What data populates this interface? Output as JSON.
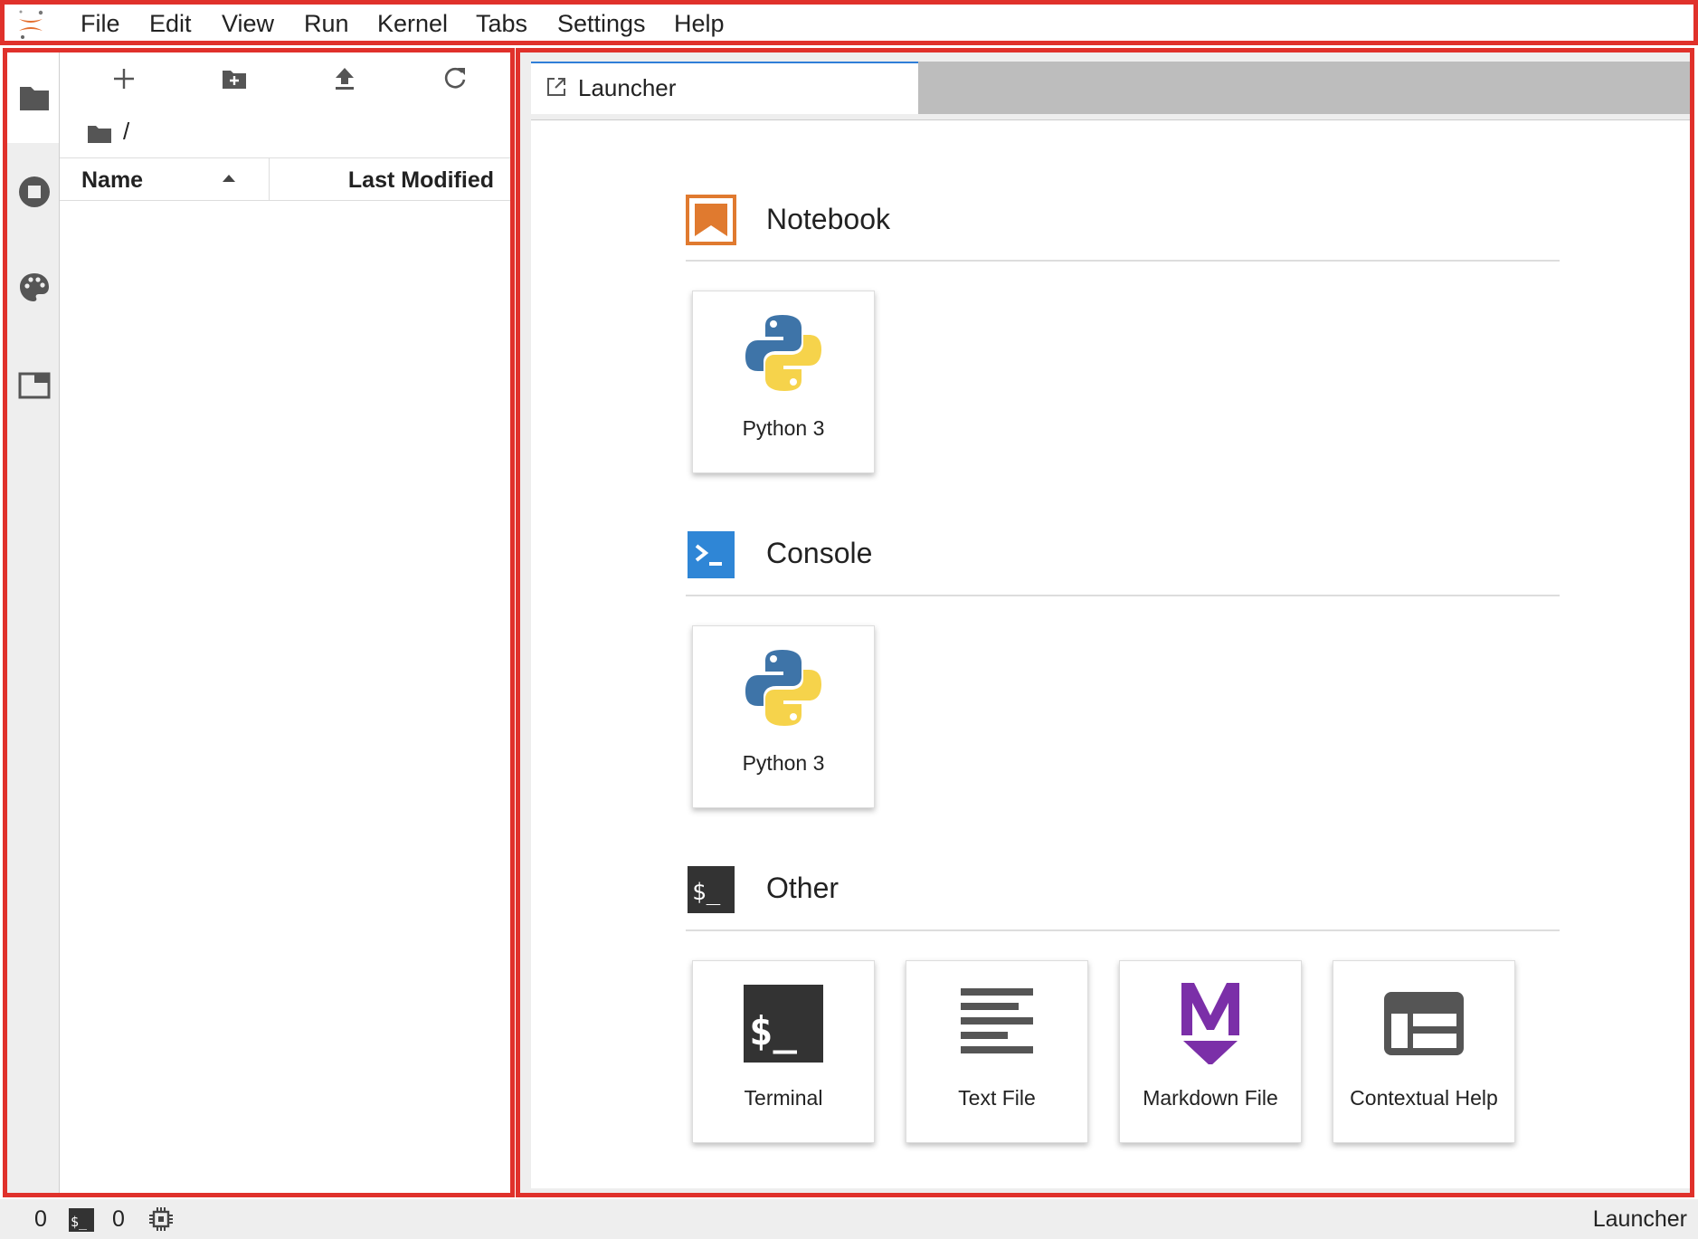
{
  "menubar": {
    "items": [
      "File",
      "Edit",
      "View",
      "Run",
      "Kernel",
      "Tabs",
      "Settings",
      "Help"
    ]
  },
  "filebrowser": {
    "breadcrumb": "/",
    "columns": {
      "name": "Name",
      "modified": "Last Modified"
    }
  },
  "tabs": [
    {
      "label": "Launcher"
    }
  ],
  "launcher": {
    "sections": [
      {
        "title": "Notebook",
        "cards": [
          {
            "label": "Python 3",
            "icon": "python-icon"
          }
        ]
      },
      {
        "title": "Console",
        "cards": [
          {
            "label": "Python 3",
            "icon": "python-icon"
          }
        ]
      },
      {
        "title": "Other",
        "cards": [
          {
            "label": "Terminal",
            "icon": "terminal-icon"
          },
          {
            "label": "Text File",
            "icon": "text-file-icon"
          },
          {
            "label": "Markdown File",
            "icon": "markdown-icon"
          },
          {
            "label": "Contextual Help",
            "icon": "contextual-help-icon"
          }
        ]
      }
    ]
  },
  "statusbar": {
    "kernels": "0",
    "terminals": "0",
    "mode": "Launcher"
  },
  "colors": {
    "accent": "#2f7ed8",
    "notebook": "#e07a2f",
    "console": "#2f86d6",
    "markdown": "#7b2fa8",
    "highlight": "#e0312b"
  }
}
